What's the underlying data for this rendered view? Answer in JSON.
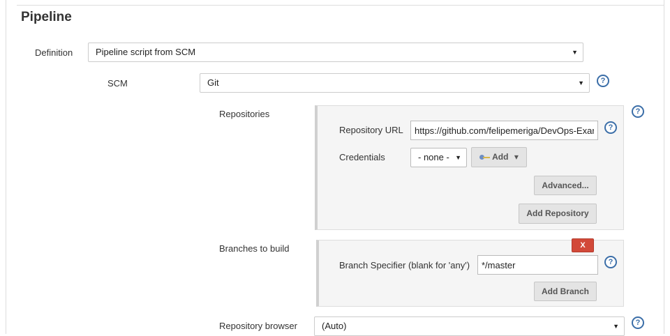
{
  "section": {
    "title": "Pipeline"
  },
  "definition": {
    "label": "Definition",
    "value": "Pipeline script from SCM"
  },
  "scm": {
    "label": "SCM",
    "value": "Git"
  },
  "repositories": {
    "label": "Repositories",
    "url_label": "Repository URL",
    "url_value": "https://github.com/felipemeriga/DevOps-Exar",
    "credentials_label": "Credentials",
    "credentials_value": "- none -",
    "add_label": "Add",
    "advanced_label": "Advanced...",
    "add_repository_label": "Add Repository"
  },
  "branches": {
    "label": "Branches to build",
    "delete_label": "X",
    "specifier_label": "Branch Specifier (blank for 'any')",
    "specifier_value": "*/master",
    "add_branch_label": "Add Branch"
  },
  "browser": {
    "label": "Repository browser",
    "value": "(Auto)"
  },
  "help": {
    "glyph": "?"
  },
  "icons": {
    "select_arrow": "▼",
    "add_caret": "▾"
  },
  "colors": {
    "delete_button": "#d24939",
    "help_icon": "#3b6ea8"
  }
}
